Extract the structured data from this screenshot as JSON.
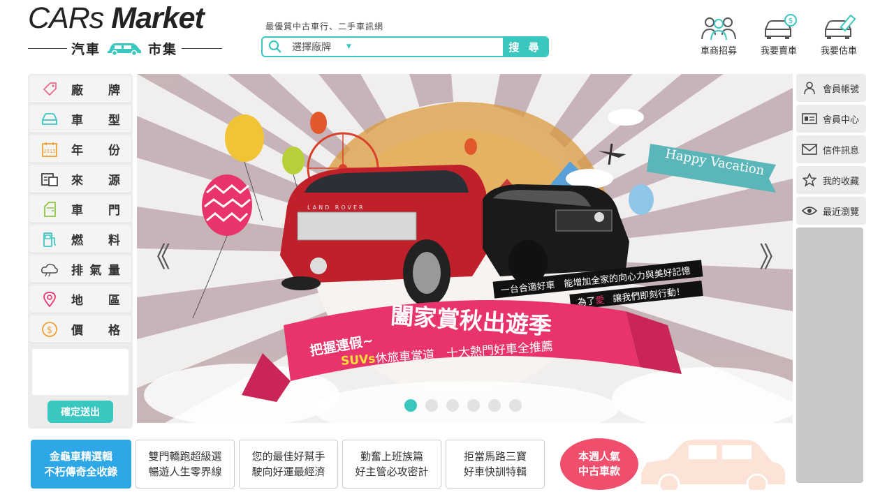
{
  "logo": {
    "title_light": "CARs",
    "title_bold": "Market",
    "sub_left": "汽車",
    "sub_right": "市集"
  },
  "tagline": "最優質中古車行、二手車訊網",
  "search": {
    "select_label": "選擇廠牌",
    "button_label": "搜 尋"
  },
  "top_actions": [
    {
      "label": "車商招募",
      "icon": "recruit-people-icon"
    },
    {
      "label": "我要賣車",
      "icon": "sell-car-icon"
    },
    {
      "label": "我要估車",
      "icon": "estimate-car-icon"
    }
  ],
  "left_menu": [
    {
      "label": [
        "廠",
        "牌"
      ],
      "icon": "tag-icon"
    },
    {
      "label": [
        "車",
        "型"
      ],
      "icon": "car-type-icon"
    },
    {
      "label": [
        "年",
        "份"
      ],
      "icon": "calendar-icon",
      "icon_text": "2015"
    },
    {
      "label": [
        "來",
        "源"
      ],
      "icon": "source-icon"
    },
    {
      "label": [
        "車",
        "門"
      ],
      "icon": "door-icon"
    },
    {
      "label": [
        "燃",
        "料"
      ],
      "icon": "fuel-icon"
    },
    {
      "label": [
        "排",
        "氣",
        "量"
      ],
      "icon": "exhaust-icon"
    },
    {
      "label": [
        "地",
        "區"
      ],
      "icon": "location-icon"
    },
    {
      "label": [
        "價",
        "格"
      ],
      "icon": "price-icon"
    }
  ],
  "left_submit": "確定送出",
  "banner": {
    "ribbon_main": "闔家賞秋出遊季",
    "ribbon_prefix": "把握連假~",
    "ribbon_sub_highlight": "SUVs",
    "ribbon_sub": "休旅車當道　十大熱門好車全推薦",
    "slogan_line1": "一台合適好車　能增加全家的向心力與美好記憶",
    "slogan_line2_a": "為了",
    "slogan_line2_love": "愛",
    "slogan_line2_b": "讓我們即刻行動！",
    "flag_text": "Happy Vacation",
    "grille_text": "LAND ROVER",
    "prev": "《",
    "next": "》",
    "dots": 6,
    "active_dot": 0
  },
  "right_menu": [
    {
      "label": "會員帳號",
      "icon": "user-icon"
    },
    {
      "label": "會員中心",
      "icon": "id-card-icon"
    },
    {
      "label": "信件訊息",
      "icon": "mail-icon"
    },
    {
      "label": "我的收藏",
      "icon": "star-icon"
    },
    {
      "label": "最近瀏覽",
      "icon": "eye-icon"
    }
  ],
  "bottom_cards": [
    {
      "line1": "金龜車精選輯",
      "line2": "不朽傳奇全收錄",
      "featured": true
    },
    {
      "line1": "雙門轎跑超級選",
      "line2": "暢遊人生零界線"
    },
    {
      "line1": "您的最佳好幫手",
      "line2": "駛向好運最經濟"
    },
    {
      "line1": "勤奮上班族篇",
      "line2": "好主管必攻密計"
    },
    {
      "line1": "拒當馬路三寶",
      "line2": "好車快訓特輯"
    }
  ],
  "popular": {
    "line1": "本週人氣",
    "line2": "中古車款"
  },
  "colors": {
    "accent": "#39c7c0",
    "featured_blue": "#2ea7e6",
    "popular_pink": "#ef4f6c",
    "ribbon_pink": "#e8336b"
  }
}
